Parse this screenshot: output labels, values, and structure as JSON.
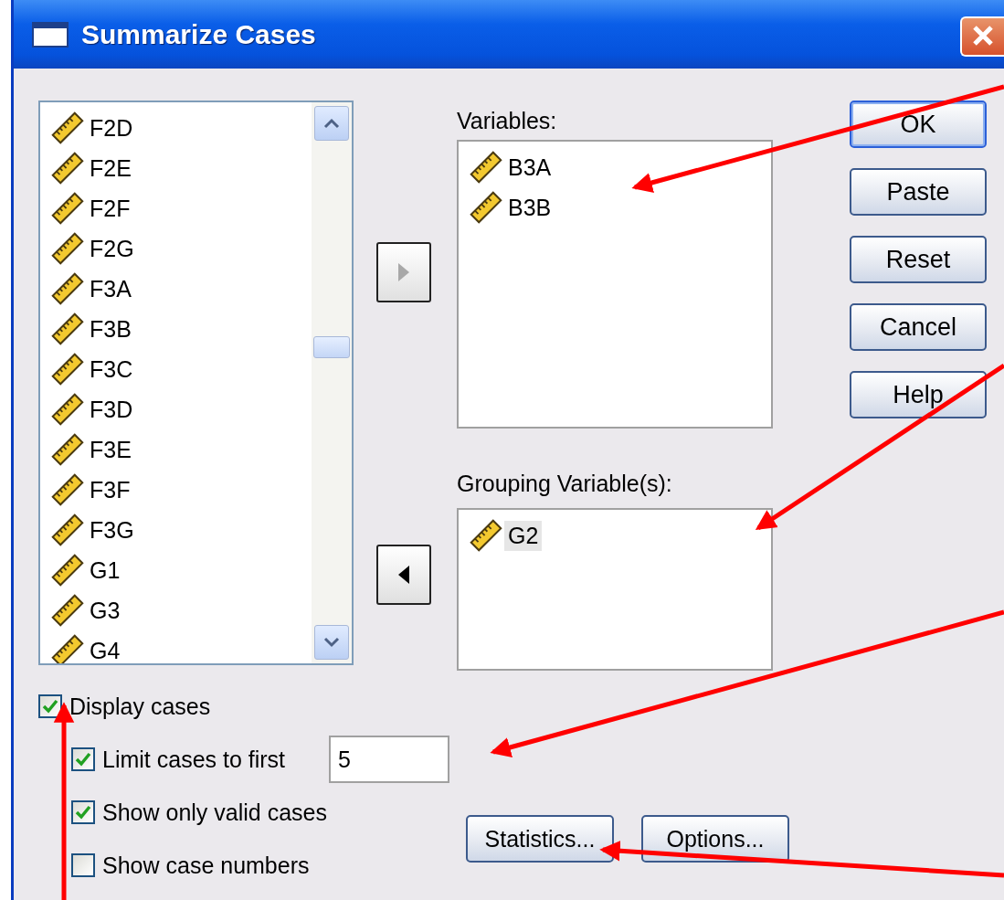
{
  "window": {
    "title": "Summarize Cases"
  },
  "source_list": {
    "items": [
      "F2D",
      "F2E",
      "F2F",
      "F2G",
      "F3A",
      "F3B",
      "F3C",
      "F3D",
      "F3E",
      "F3F",
      "F3G",
      "G1",
      "G3",
      "G4"
    ]
  },
  "move_buttons": [
    {
      "kind": "right",
      "disabled": true
    },
    {
      "kind": "left",
      "disabled": false
    }
  ],
  "variables": {
    "label": "Variables:",
    "items": [
      {
        "name": "B3A",
        "selected": false
      },
      {
        "name": "B3B",
        "selected": false
      }
    ]
  },
  "grouping": {
    "label": "Grouping Variable(s):",
    "items": [
      {
        "name": "G2",
        "selected": true
      }
    ]
  },
  "buttons": [
    {
      "label": "OK",
      "default": true
    },
    {
      "label": "Paste",
      "default": false
    },
    {
      "label": "Reset",
      "default": false
    },
    {
      "label": "Cancel",
      "default": false
    },
    {
      "label": "Help",
      "default": false
    }
  ],
  "display_cases": {
    "label": "Display cases",
    "checked": true
  },
  "sub_options": [
    {
      "label": "Limit cases to first",
      "checked": true,
      "value": "5"
    },
    {
      "label": "Show only valid cases",
      "checked": true
    },
    {
      "label": "Show case numbers",
      "checked": false
    }
  ],
  "bottom_buttons": [
    "Statistics...",
    "Options..."
  ]
}
